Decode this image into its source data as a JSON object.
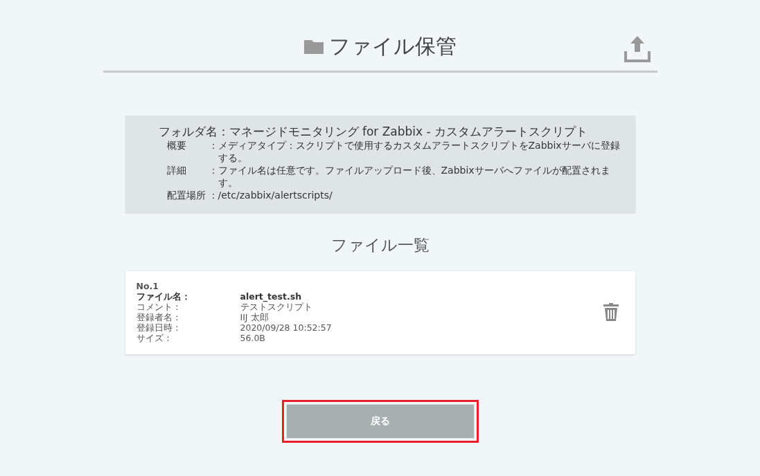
{
  "header": {
    "title": "ファイル保管"
  },
  "folder_info": {
    "title": "フォルダ名：マネージドモニタリング for Zabbix - カスタムアラートスクリプト",
    "rows": [
      {
        "label": "概要",
        "separator": "：",
        "value": "メディアタイプ：スクリプトで使用するカスタムアラートスクリプトをZabbixサーバに登録する。"
      },
      {
        "label": "詳細",
        "separator": "：",
        "value": "ファイル名は任意です。ファイルアップロード後、Zabbixサーバへファイルが配置されます。"
      },
      {
        "label": "配置場所",
        "separator": "：",
        "value": "/etc/zabbix/alertscripts/"
      }
    ]
  },
  "file_list": {
    "title": "ファイル一覧",
    "files": [
      {
        "number": "No.1",
        "fields": [
          {
            "label": "ファイル名：",
            "value": "alert_test.sh",
            "bold": true
          },
          {
            "label": "コメント：",
            "value": "テストスクリプト",
            "bold": false
          },
          {
            "label": "登録者名：",
            "value": "IIJ 太郎",
            "bold": false
          },
          {
            "label": "登録日時：",
            "value": "2020/09/28 10:52:57",
            "bold": false
          },
          {
            "label": "サイズ：",
            "value": "56.0B",
            "bold": false
          }
        ]
      }
    ]
  },
  "back_button": {
    "label": "戻る",
    "highlighted": true
  }
}
